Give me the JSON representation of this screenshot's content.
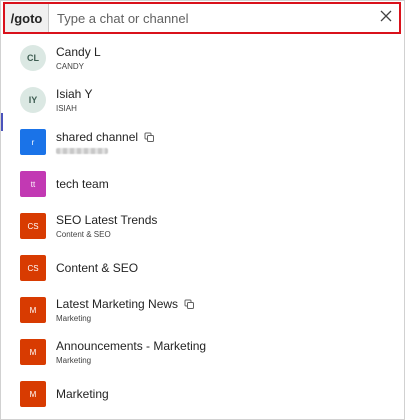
{
  "search": {
    "prefix": "/goto",
    "placeholder": "Type a chat or channel",
    "value": ""
  },
  "items": [
    {
      "title": "Candy L",
      "subtitle": "CANDY",
      "avatar_text": "CL",
      "avatar_shape": "round",
      "avatar_color": "#dbe8e3",
      "shared": false,
      "blurred": false
    },
    {
      "title": "Isiah Y",
      "subtitle": "ISIAH",
      "avatar_text": "IY",
      "avatar_shape": "round",
      "avatar_color": "#dbe8e3",
      "shared": false,
      "blurred": false
    },
    {
      "title": "shared channel",
      "subtitle": "",
      "avatar_text": "r",
      "avatar_shape": "square",
      "avatar_color": "#1a73e8",
      "shared": true,
      "blurred": true
    },
    {
      "title": "tech team",
      "subtitle": "",
      "avatar_text": "tt",
      "avatar_shape": "square",
      "avatar_color": "#c239b3",
      "shared": false,
      "blurred": false
    },
    {
      "title": "SEO Latest Trends",
      "subtitle": "Content & SEO",
      "avatar_text": "CS",
      "avatar_shape": "square",
      "avatar_color": "#d83b01",
      "shared": false,
      "blurred": false
    },
    {
      "title": "Content & SEO",
      "subtitle": "",
      "avatar_text": "CS",
      "avatar_shape": "square",
      "avatar_color": "#d83b01",
      "shared": false,
      "blurred": false
    },
    {
      "title": "Latest Marketing News",
      "subtitle": "Marketing",
      "avatar_text": "M",
      "avatar_shape": "square",
      "avatar_color": "#d83b01",
      "shared": true,
      "blurred": false
    },
    {
      "title": "Announcements - Marketing",
      "subtitle": "Marketing",
      "avatar_text": "M",
      "avatar_shape": "square",
      "avatar_color": "#d83b01",
      "shared": false,
      "blurred": false
    },
    {
      "title": "Marketing",
      "subtitle": "",
      "avatar_text": "M",
      "avatar_shape": "square",
      "avatar_color": "#d83b01",
      "shared": false,
      "blurred": false
    }
  ],
  "icons": {
    "clear": "close-icon",
    "shared": "shared-channel-icon"
  },
  "colors": {
    "focus_border": "#d9111b",
    "prefix_bg": "#f0f0f0"
  }
}
